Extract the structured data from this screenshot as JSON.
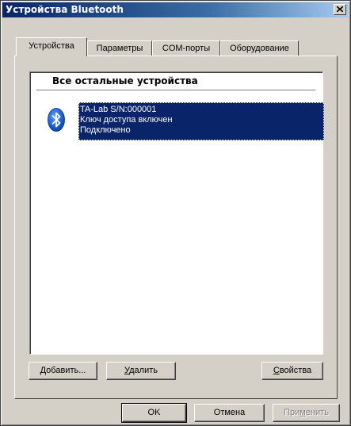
{
  "window": {
    "title": "Устройства Bluetooth"
  },
  "tabs": [
    {
      "label": "Устройства",
      "active": true
    },
    {
      "label": "Параметры",
      "active": false
    },
    {
      "label": "COM-порты",
      "active": false
    },
    {
      "label": "Оборудование",
      "active": false
    }
  ],
  "device_list": {
    "group_header": "Все остальные устройства",
    "items": [
      {
        "icon": "bluetooth-icon",
        "lines": [
          "TA-Lab S/N:000001",
          "Ключ доступа включен",
          "Подключено"
        ],
        "selected": true
      }
    ]
  },
  "panel_buttons": {
    "add": {
      "prefix": "Д",
      "rest": "обавить..."
    },
    "remove": {
      "prefix": "У",
      "rest": "далить"
    },
    "properties": {
      "prefix": "С",
      "rest": "войства"
    }
  },
  "dialog_buttons": {
    "ok": "OK",
    "cancel": "Отмена",
    "apply": {
      "before": "При",
      "underline": "м",
      "after": "енить",
      "disabled": true
    }
  },
  "colors": {
    "face": "#d4d0c8",
    "title_start": "#0a246a",
    "selection": "#0a246a",
    "bluetooth": "#0055c8"
  }
}
